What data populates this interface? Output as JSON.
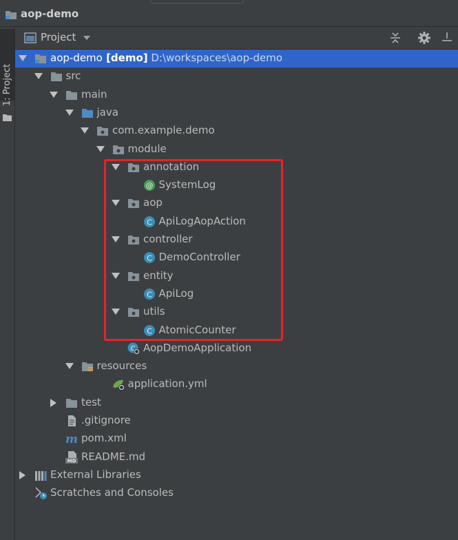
{
  "window": {
    "title": "aop-demo"
  },
  "side_tool_window": {
    "label": "1: Project"
  },
  "panel": {
    "title": "Project",
    "tools": {
      "collapse": "collapse-all-icon",
      "settings": "gear-icon",
      "hide": "hide-icon"
    }
  },
  "tree": [
    {
      "label": "aop-demo",
      "suffix": "[demo]",
      "path": "D:\\workspaces\\aop-demo",
      "depth": 0,
      "icon": "module-folder",
      "expanded": true,
      "selected": true
    },
    {
      "label": "src",
      "depth": 1,
      "icon": "folder",
      "expanded": true
    },
    {
      "label": "main",
      "depth": 2,
      "icon": "folder",
      "expanded": true
    },
    {
      "label": "java",
      "depth": 3,
      "icon": "source-folder",
      "expanded": true
    },
    {
      "label": "com.example.demo",
      "depth": 4,
      "icon": "package",
      "expanded": true
    },
    {
      "label": "module",
      "depth": 5,
      "icon": "package",
      "expanded": true
    },
    {
      "label": "annotation",
      "depth": 6,
      "icon": "package",
      "expanded": true
    },
    {
      "label": "SystemLog",
      "depth": 7,
      "icon": "annotation"
    },
    {
      "label": "aop",
      "depth": 6,
      "icon": "package",
      "expanded": true
    },
    {
      "label": "ApiLogAopAction",
      "depth": 7,
      "icon": "class"
    },
    {
      "label": "controller",
      "depth": 6,
      "icon": "package",
      "expanded": true
    },
    {
      "label": "DemoController",
      "depth": 7,
      "icon": "class"
    },
    {
      "label": "entity",
      "depth": 6,
      "icon": "package",
      "expanded": true
    },
    {
      "label": "ApiLog",
      "depth": 7,
      "icon": "class"
    },
    {
      "label": "utils",
      "depth": 6,
      "icon": "package",
      "expanded": true
    },
    {
      "label": "AtomicCounter",
      "depth": 7,
      "icon": "class"
    },
    {
      "label": "AopDemoApplication",
      "depth": 6,
      "icon": "spring-class"
    },
    {
      "label": "resources",
      "depth": 3,
      "icon": "resources-folder",
      "expanded": true
    },
    {
      "label": "application.yml",
      "depth": 5,
      "icon": "spring-yml"
    },
    {
      "label": "test",
      "depth": 2,
      "icon": "folder",
      "expanded": false
    },
    {
      "label": ".gitignore",
      "depth": 2,
      "icon": "text-file"
    },
    {
      "label": "pom.xml",
      "depth": 2,
      "icon": "maven"
    },
    {
      "label": "README.md",
      "depth": 2,
      "icon": "markdown"
    },
    {
      "label": "External Libraries",
      "depth": 0,
      "icon": "libraries",
      "expanded": false
    },
    {
      "label": "Scratches and Consoles",
      "depth": 0,
      "icon": "scratches"
    }
  ],
  "colors": {
    "background": "#3c3f41",
    "selection": "#2f65ca",
    "highlight_box": "#e8232a",
    "class_icon": "#3a8fb7",
    "annotation_icon": "#4a9d56",
    "folder": "#87939a",
    "source_folder": "#4f8ac6"
  }
}
